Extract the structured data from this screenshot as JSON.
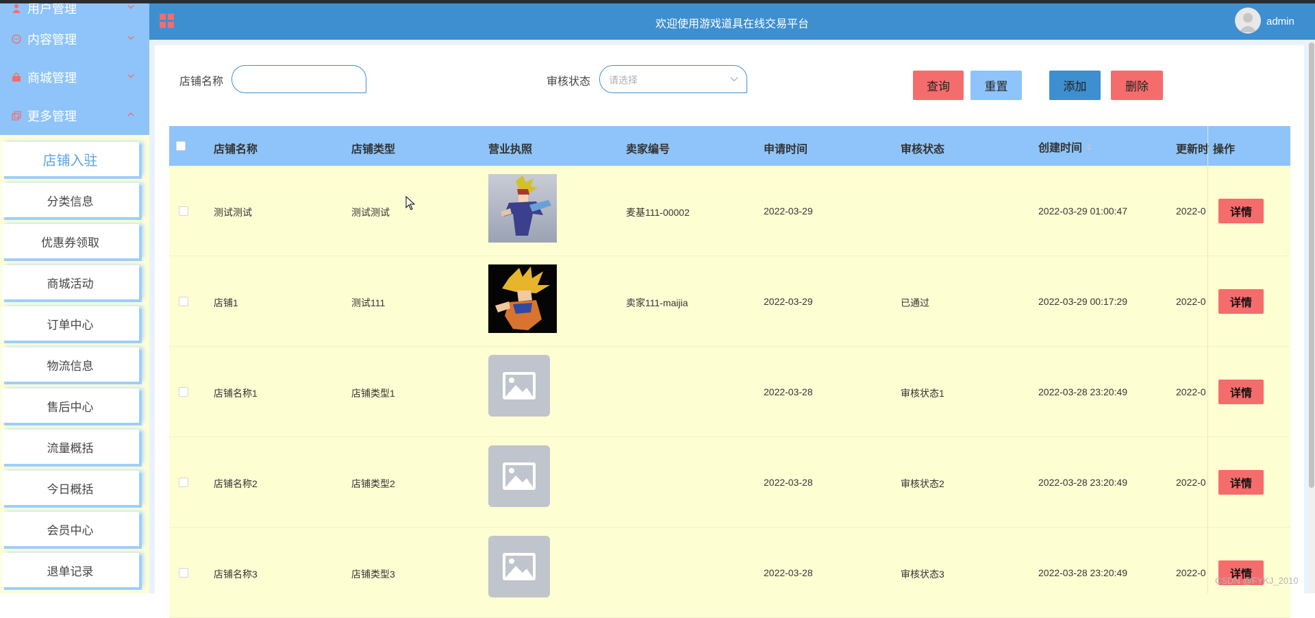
{
  "header": {
    "title": "欢迎使用游戏道具在线交易平台",
    "username": "admin"
  },
  "sidebar": {
    "groups": [
      {
        "label": "用户管理",
        "icon": "user-icon"
      },
      {
        "label": "内容管理",
        "icon": "message-icon"
      },
      {
        "label": "商城管理",
        "icon": "shop-icon"
      },
      {
        "label": "更多管理",
        "icon": "copy-icon"
      }
    ],
    "items": [
      {
        "label": "店铺入驻",
        "active": true
      },
      {
        "label": "分类信息"
      },
      {
        "label": "优惠券领取"
      },
      {
        "label": "商城活动"
      },
      {
        "label": "订单中心"
      },
      {
        "label": "物流信息"
      },
      {
        "label": "售后中心"
      },
      {
        "label": "流量概括"
      },
      {
        "label": "今日概括"
      },
      {
        "label": "会员中心"
      },
      {
        "label": "退单记录"
      }
    ]
  },
  "search": {
    "shop_name_label": "店铺名称",
    "shop_name_value": "",
    "status_label": "审核状态",
    "status_placeholder": "请选择",
    "query": "查询",
    "reset": "重置",
    "add": "添加",
    "delete": "删除"
  },
  "colors": {
    "header": "#3d8fd0",
    "sidebar_group": "#8ec4f9",
    "row_bg": "#fefed3",
    "danger": "#f56c6c"
  },
  "table": {
    "columns": [
      "店铺名称",
      "店铺类型",
      "营业执照",
      "卖家编号",
      "申请时间",
      "审核状态",
      "创建时间",
      "更新时",
      "操作"
    ],
    "detail_label": "详情",
    "rows": [
      {
        "name": "测试测试",
        "type": "测试测试",
        "seller": "麦基111-00002",
        "apply": "2022-03-29",
        "status": "",
        "created": "2022-03-29 01:00:47",
        "updated": "2022-0",
        "image": "photo-1"
      },
      {
        "name": "店铺1",
        "type": "测试111",
        "seller": "卖家111-maijia",
        "apply": "2022-03-29",
        "status": "已通过",
        "created": "2022-03-29 00:17:29",
        "updated": "2022-0",
        "image": "photo-2"
      },
      {
        "name": "店铺名称1",
        "type": "店铺类型1",
        "seller": "",
        "apply": "2022-03-28",
        "status": "审核状态1",
        "created": "2022-03-28 23:20:49",
        "updated": "2022-0",
        "image": "placeholder"
      },
      {
        "name": "店铺名称2",
        "type": "店铺类型2",
        "seller": "",
        "apply": "2022-03-28",
        "status": "审核状态2",
        "created": "2022-03-28 23:20:49",
        "updated": "2022-0",
        "image": "placeholder"
      },
      {
        "name": "店铺名称3",
        "type": "店铺类型3",
        "seller": "",
        "apply": "2022-03-28",
        "status": "审核状态3",
        "created": "2022-03-28 23:20:49",
        "updated": "2022-0",
        "image": "placeholder"
      }
    ]
  },
  "watermark": "CSDN @FYKJ_2010"
}
